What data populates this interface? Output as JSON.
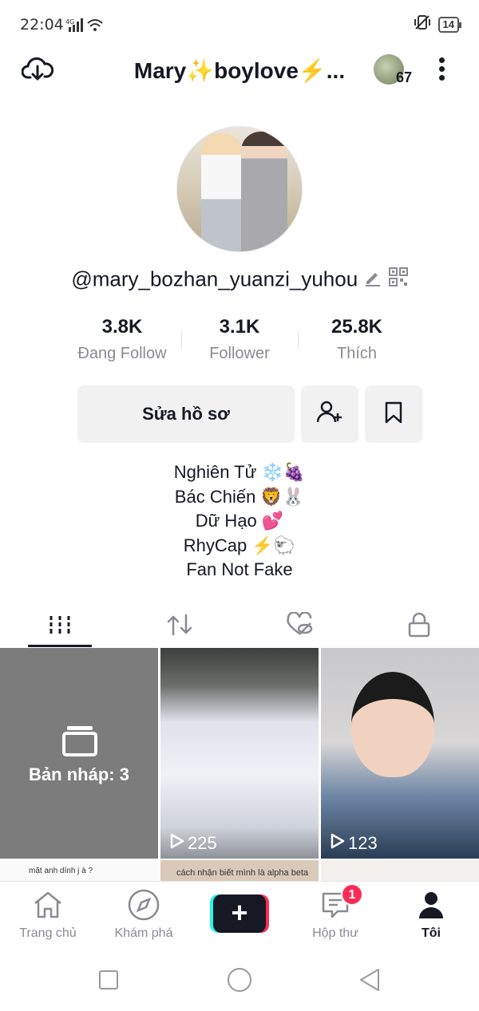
{
  "status_bar": {
    "time": "22:04",
    "network": "4G",
    "battery": "14"
  },
  "header": {
    "title": "Mary✨boylove⚡...",
    "friends_count": "67"
  },
  "profile": {
    "username": "@mary_bozhan_yuanzi_yuhou",
    "stats": [
      {
        "value": "3.8K",
        "label": "Đang Follow"
      },
      {
        "value": "3.1K",
        "label": "Follower"
      },
      {
        "value": "25.8K",
        "label": "Thích"
      }
    ],
    "edit_button": "Sửa hồ sơ",
    "bio": [
      "Nghiên Tử ❄️🍇",
      "Bác Chiến 🦁🐰",
      "Dữ Hạo 💕",
      "RhyCap ⚡🐑",
      "Fan Not Fake"
    ]
  },
  "tabs": [
    "videos-tab",
    "reposts-tab",
    "liked-tab",
    "private-tab"
  ],
  "grid": {
    "draft_label": "Bản nháp: 3",
    "videos": [
      {
        "views": "225"
      },
      {
        "views": "123"
      }
    ],
    "row2": [
      "mặt anh dính j à ?",
      "cách nhận biết mình là alpha beta"
    ]
  },
  "bottom_nav": {
    "home": "Trang chủ",
    "discover": "Khám phá",
    "inbox": "Hộp thư",
    "inbox_badge": "1",
    "me": "Tôi"
  },
  "colors": {
    "accent": "#fe2c55",
    "cyan": "#25f4ee",
    "text": "#161823",
    "muted": "#8a8b91"
  }
}
